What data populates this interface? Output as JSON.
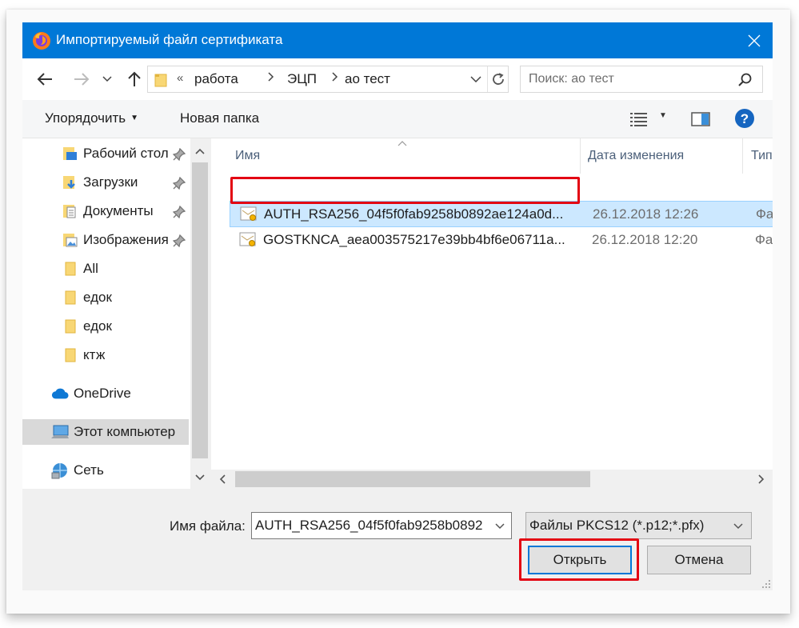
{
  "window": {
    "title": "Импортируемый файл сертификата"
  },
  "address": {
    "overflow": "«",
    "crumbs": [
      "работа",
      "ЭЦП",
      "ао тест"
    ]
  },
  "search": {
    "placeholder": "Поиск: ао тест"
  },
  "toolbar": {
    "organize": "Упорядочить",
    "new_folder": "Новая папка"
  },
  "nav": {
    "items": [
      {
        "label": "Рабочий стол",
        "icon": "desktop-folder-icon",
        "pinned": true
      },
      {
        "label": "Загрузки",
        "icon": "downloads-folder-icon",
        "pinned": true
      },
      {
        "label": "Документы",
        "icon": "documents-folder-icon",
        "pinned": true
      },
      {
        "label": "Изображения",
        "icon": "pictures-folder-icon",
        "pinned": true
      },
      {
        "label": "All",
        "icon": "folder-icon",
        "pinned": false
      },
      {
        "label": "едок",
        "icon": "folder-icon",
        "pinned": false
      },
      {
        "label": "едок",
        "icon": "folder-icon",
        "pinned": false
      },
      {
        "label": "ктж",
        "icon": "folder-icon",
        "pinned": false
      }
    ],
    "onedrive": "OneDrive",
    "this_pc": "Этот компьютер",
    "network": "Сеть"
  },
  "columns": {
    "name": "Имя",
    "date": "Дата изменения",
    "type": "Тип"
  },
  "files": [
    {
      "name": "AUTH_RSA256_04f5f0fab9258b0892ae124a0d...",
      "date": "26.12.2018 12:26",
      "type": "Фай",
      "selected": true
    },
    {
      "name": "GOSTKNCA_aea003575217e39bb4bf6e06711a...",
      "date": "26.12.2018 12:20",
      "type": "Фай",
      "selected": false
    }
  ],
  "bottom": {
    "filename_label": "Имя файла:",
    "filename_value": "AUTH_RSA256_04f5f0fab9258b0892",
    "filter": "Файлы PKCS12 (*.p12;*.pfx)",
    "open": "Открыть",
    "cancel": "Отмена"
  },
  "colors": {
    "titlebar": "#0078d7",
    "selection": "#cce8ff",
    "highlight_box": "#e30613"
  }
}
